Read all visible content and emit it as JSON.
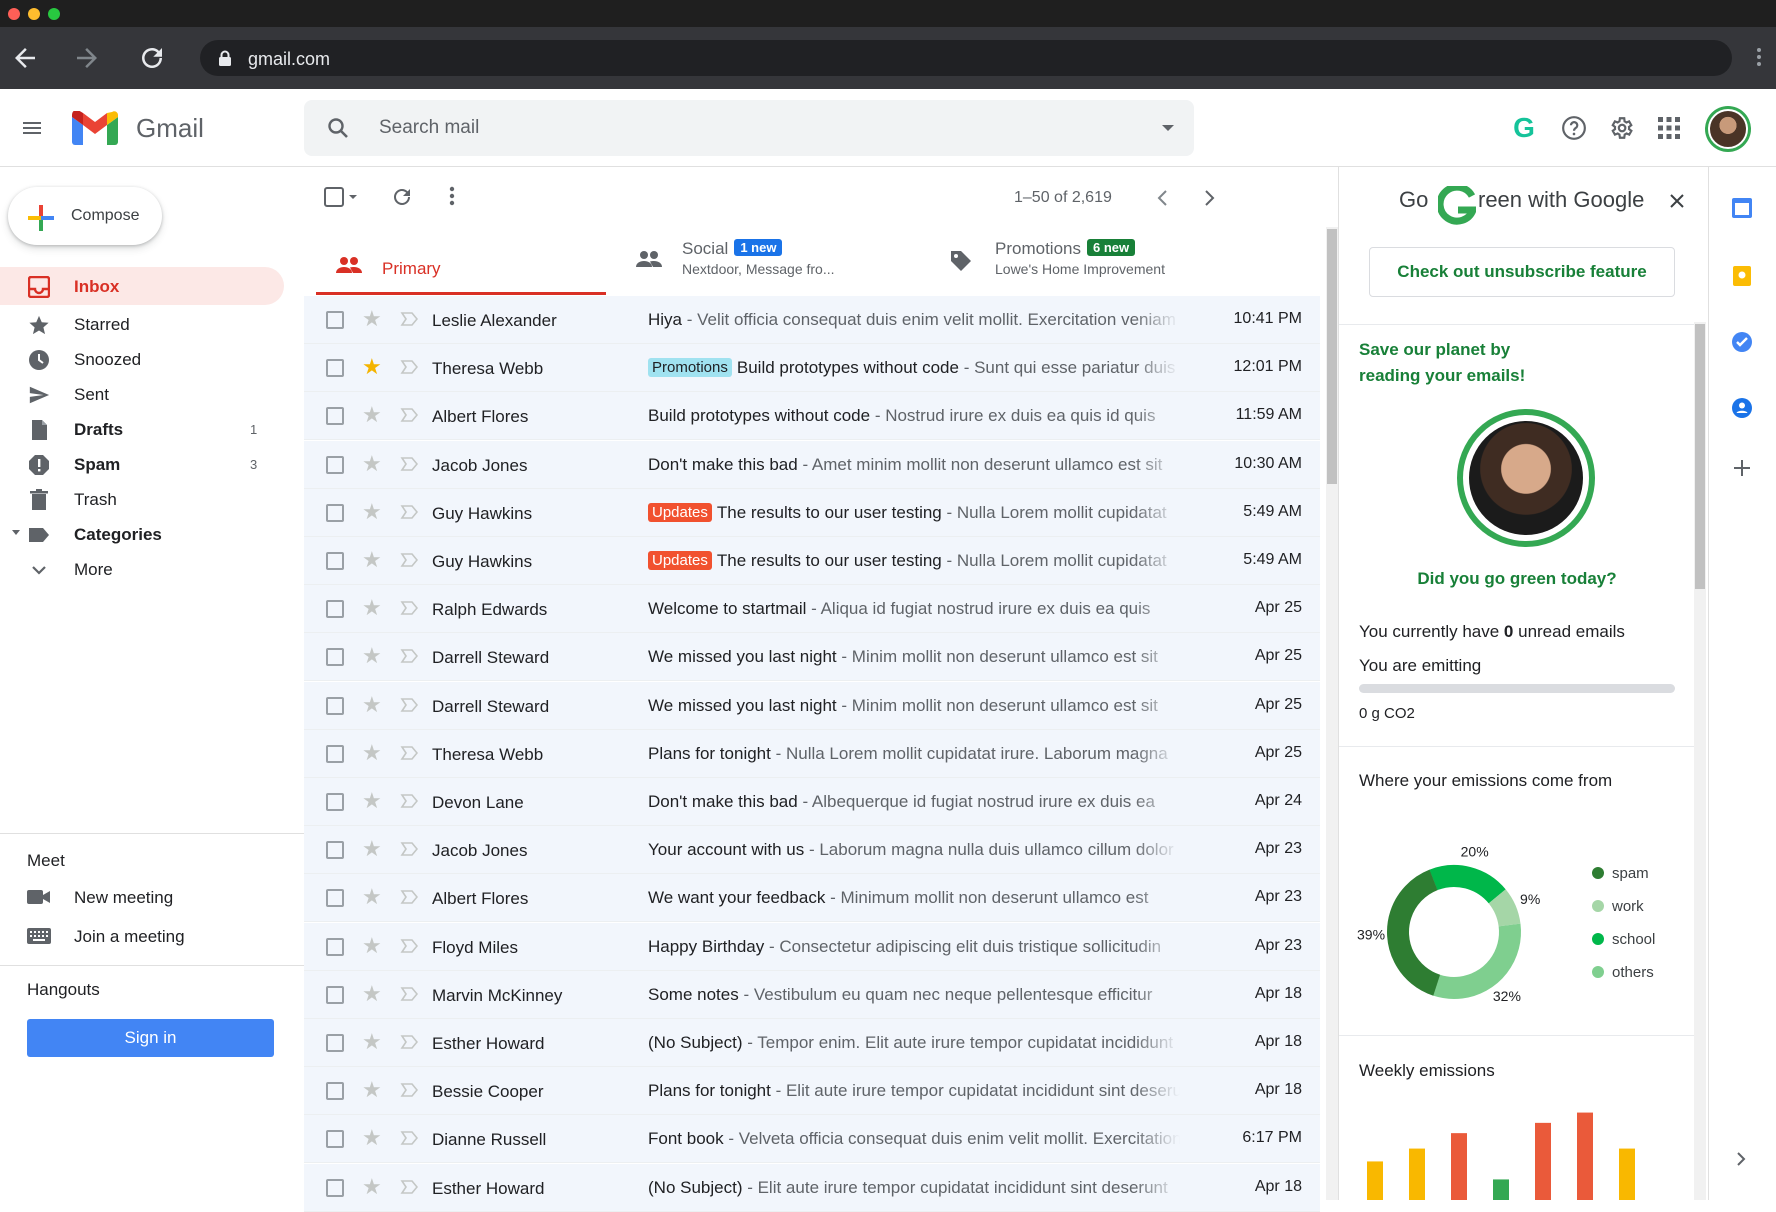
{
  "browser": {
    "url": "gmail.com"
  },
  "header": {
    "app_name": "Gmail",
    "search_placeholder": "Search mail",
    "grammarly_glyph": "G"
  },
  "sidebar": {
    "compose_label": "Compose",
    "items": [
      {
        "label": "Inbox",
        "count": "",
        "icon": "inbox-icon"
      },
      {
        "label": "Starred",
        "count": "",
        "icon": "star-icon"
      },
      {
        "label": "Snoozed",
        "count": "",
        "icon": "clock-icon"
      },
      {
        "label": "Sent",
        "count": "",
        "icon": "send-icon"
      },
      {
        "label": "Drafts",
        "count": "1",
        "icon": "draft-icon"
      },
      {
        "label": "Spam",
        "count": "3",
        "icon": "spam-icon"
      },
      {
        "label": "Trash",
        "count": "",
        "icon": "trash-icon"
      },
      {
        "label": "Categories",
        "count": "",
        "icon": "label-icon"
      },
      {
        "label": "More",
        "count": "",
        "icon": "chevron-down-icon"
      }
    ],
    "meet": {
      "title": "Meet",
      "new_meeting": "New meeting",
      "join_meeting": "Join a meeting"
    },
    "hangouts": {
      "title": "Hangouts",
      "sign_in": "Sign in"
    }
  },
  "toolbar": {
    "pager": "1–50 of 2,619"
  },
  "tabs": [
    {
      "name": "Primary",
      "badge": "",
      "sub": ""
    },
    {
      "name": "Social",
      "badge": "1 new",
      "sub": "Nextdoor, Message fro..."
    },
    {
      "name": "Promotions",
      "badge": "6 new",
      "sub": "Lowe's Home Improvement"
    }
  ],
  "emails": [
    {
      "sender": "Leslie Alexander",
      "label": "",
      "subject": "Hiya",
      "snippet": " - Velit officia consequat duis enim velit mollit. Exercitation veniam",
      "date": "10:41 PM",
      "starred": false
    },
    {
      "sender": "Theresa Webb",
      "label": "Promotions",
      "subject": "Build prototypes without code",
      "snippet": " - Sunt qui esse pariatur duis",
      "date": "12:01 PM",
      "starred": true
    },
    {
      "sender": "Albert Flores",
      "label": "",
      "subject": "Build prototypes without code",
      "snippet": " - Nostrud irure ex duis ea quis id quis",
      "date": "11:59 AM",
      "starred": false
    },
    {
      "sender": "Jacob Jones",
      "label": "",
      "subject": "Don't make this bad",
      "snippet": " - Amet minim mollit non deserunt ullamco est sit",
      "date": "10:30 AM",
      "starred": false
    },
    {
      "sender": "Guy Hawkins",
      "label": "Updates",
      "subject": "The results to our user testing",
      "snippet": " - Nulla Lorem mollit cupidatat",
      "date": "5:49 AM",
      "starred": false
    },
    {
      "sender": "Guy Hawkins",
      "label": "Updates",
      "subject": "The results to our user testing",
      "snippet": " - Nulla Lorem mollit cupidatat",
      "date": "5:49 AM",
      "starred": false
    },
    {
      "sender": "Ralph Edwards",
      "label": "",
      "subject": "Welcome to startmail",
      "snippet": " - Aliqua id fugiat nostrud irure ex duis ea quis",
      "date": "Apr 25",
      "starred": false
    },
    {
      "sender": "Darrell Steward",
      "label": "",
      "subject": "We missed you last night",
      "snippet": " - Minim mollit non deserunt ullamco est sit",
      "date": "Apr 25",
      "starred": false
    },
    {
      "sender": "Darrell Steward",
      "label": "",
      "subject": "We missed you last night",
      "snippet": " - Minim mollit non deserunt ullamco est sit",
      "date": "Apr 25",
      "starred": false
    },
    {
      "sender": "Theresa Webb",
      "label": "",
      "subject": "Plans for tonight",
      "snippet": " - Nulla Lorem mollit cupidatat irure. Laborum magna",
      "date": "Apr 25",
      "starred": false
    },
    {
      "sender": "Devon Lane",
      "label": "",
      "subject": "Don't make this bad",
      "snippet": " - Albequerque id fugiat nostrud irure ex duis ea",
      "date": "Apr 24",
      "starred": false
    },
    {
      "sender": "Jacob Jones",
      "label": "",
      "subject": "Your account with us",
      "snippet": " - Laborum magna nulla duis ullamco cillum dolor",
      "date": "Apr 23",
      "starred": false
    },
    {
      "sender": "Albert Flores",
      "label": "",
      "subject": "We want your feedback",
      "snippet": " - Minimum mollit non deserunt ullamco est",
      "date": "Apr 23",
      "starred": false
    },
    {
      "sender": "Floyd Miles",
      "label": "",
      "subject": "Happy Birthday",
      "snippet": " - Consectetur adipiscing elit duis tristique sollicitudin",
      "date": "Apr 23",
      "starred": false
    },
    {
      "sender": "Marvin McKinney",
      "label": "",
      "subject": "Some notes",
      "snippet": " - Vestibulum eu quam nec neque pellentesque efficitur",
      "date": "Apr 18",
      "starred": false
    },
    {
      "sender": "Esther Howard",
      "label": "",
      "subject": "(No Subject)",
      "snippet": " - Tempor enim. Elit aute irure tempor cupidatat incididunt",
      "date": "Apr 18",
      "starred": false
    },
    {
      "sender": "Bessie Cooper",
      "label": "",
      "subject": "Plans for tonight",
      "snippet": " - Elit aute irure tempor cupidatat incididunt sint deserunt",
      "date": "Apr 18",
      "starred": false
    },
    {
      "sender": "Dianne Russell",
      "label": "",
      "subject": "Font book",
      "snippet": " - Velveta officia consequat duis enim velit mollit. Exercitation",
      "date": "6:17 PM",
      "starred": false
    },
    {
      "sender": "Esther Howard",
      "label": "",
      "subject": "(No Subject)",
      "snippet": " - Elit aute irure tempor cupidatat incididunt sint deserunt",
      "date": "Apr 18",
      "starred": false
    }
  ],
  "label_colors": {
    "Promotions": "#a0e2f0",
    "Updates": "#f1512f"
  },
  "green_panel": {
    "title_go": "Go",
    "title_rest": "reen  with Google",
    "unsubscribe_btn": "Check out unsubscribe feature",
    "save_text": "Save our planet by reading your emails!",
    "question": "Did you go green today?",
    "unread_prefix": "You currently have ",
    "unread_count": "0",
    "unread_suffix": " unread emails",
    "emitting": "You are emitting",
    "emission_value": "0 g CO2",
    "emission_progress": 0,
    "sources_title": "Where your emissions come from",
    "weekly_title": "Weekly emissions"
  },
  "chart_data": [
    {
      "type": "pie",
      "title": "Where your emissions come from",
      "categories": [
        "spam",
        "work",
        "school",
        "others"
      ],
      "values": [
        39,
        9,
        20,
        32
      ],
      "value_labels": [
        "39%",
        "9%",
        "20%",
        "32%"
      ],
      "colors": [
        "#2e7d32",
        "#a5d6a7",
        "#00b74a",
        "#7fcf8f"
      ],
      "legend": "right"
    },
    {
      "type": "bar",
      "title": "Weekly emissions",
      "values": [
        30,
        40,
        52,
        16,
        60,
        68,
        40
      ],
      "colors": [
        "#f9b800",
        "#f9b800",
        "#ea5a3a",
        "#34a853",
        "#ea5a3a",
        "#ea5a3a",
        "#f9b800"
      ]
    }
  ]
}
